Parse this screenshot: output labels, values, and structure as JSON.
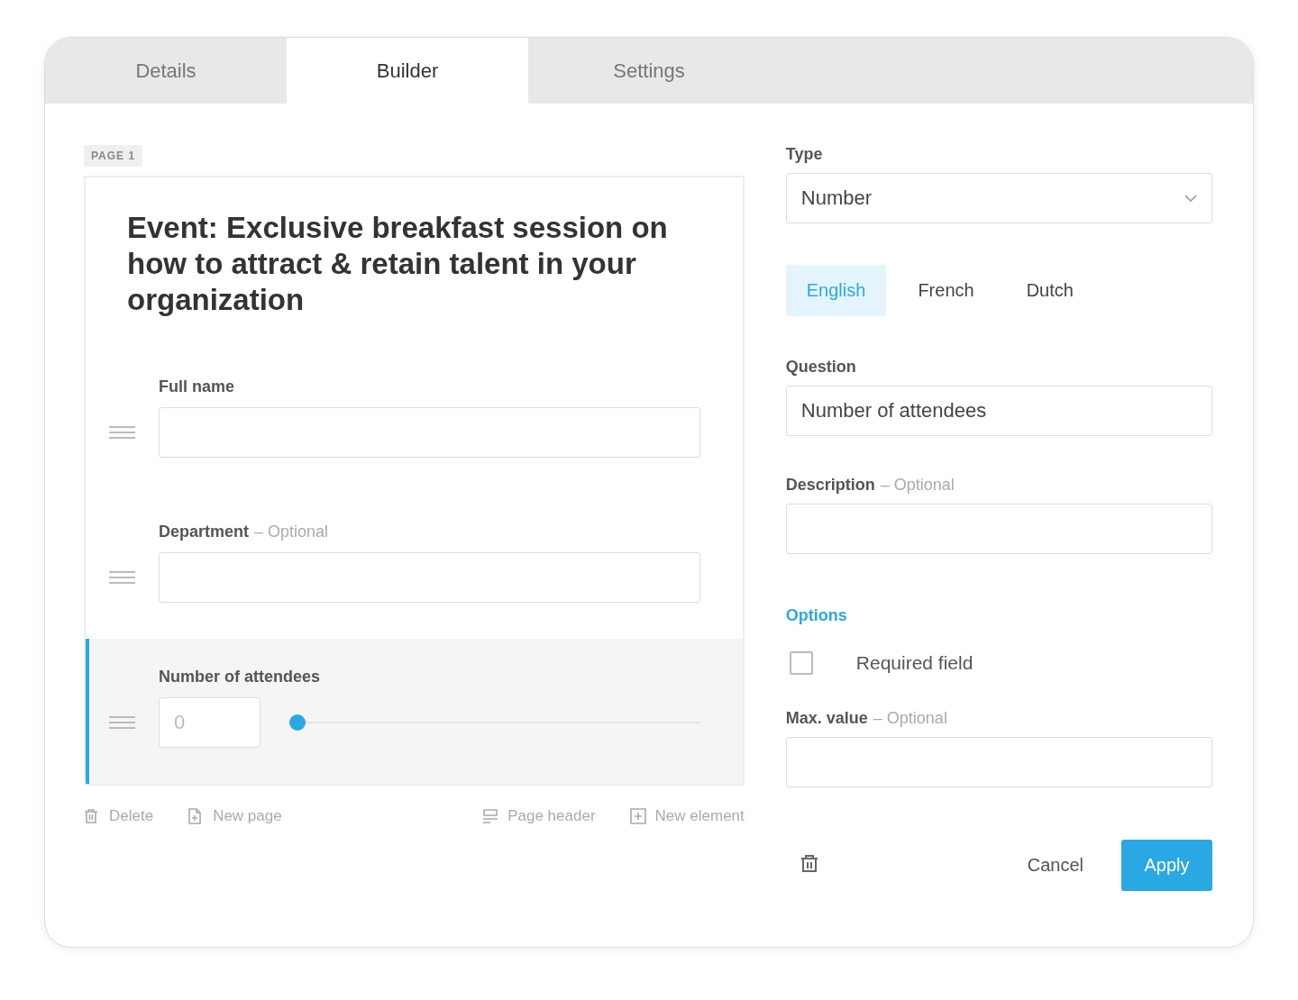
{
  "tabs": [
    {
      "label": "Details",
      "selected": false
    },
    {
      "label": "Builder",
      "selected": true
    },
    {
      "label": "Settings",
      "selected": false
    }
  ],
  "page_badge": "PAGE 1",
  "form": {
    "title": "Event: Exclusive breakfast session on how to attract & retain talent in your organization",
    "fields": [
      {
        "kind": "text",
        "label": "Full name",
        "selected": false
      },
      {
        "kind": "text",
        "label": "Department",
        "optional": "– Optional",
        "selected": false
      },
      {
        "kind": "number",
        "label": "Number of attendees",
        "placeholder": "0",
        "level": 0,
        "selected": true
      }
    ]
  },
  "actions": [
    {
      "kind": "delete",
      "label": "Delete"
    },
    {
      "kind": "new-page",
      "label": "New page"
    },
    {
      "kind": "page-header",
      "label": "Page header"
    },
    {
      "kind": "new-element",
      "label": "New element"
    }
  ],
  "panel": {
    "type": {
      "label": "Type",
      "value": "Number"
    },
    "languages": [
      {
        "label": "English",
        "selected": true
      },
      {
        "label": "French",
        "selected": false
      },
      {
        "label": "Dutch",
        "selected": false
      }
    ],
    "question": {
      "label": "Question",
      "value": "Number of attendees"
    },
    "description": {
      "label": "Description",
      "optional": "– Optional"
    },
    "options_heading": "Options",
    "required": {
      "label": "Required field",
      "checked": false
    },
    "max_value": {
      "label": "Max. value",
      "optional": "– Optional"
    },
    "cancel": "Cancel",
    "apply": "Apply"
  }
}
